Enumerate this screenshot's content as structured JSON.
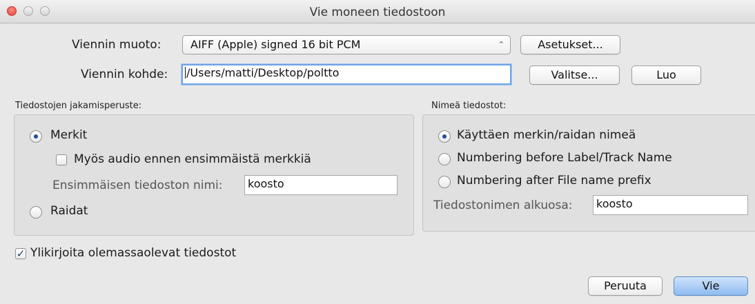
{
  "window": {
    "title": "Vie moneen tiedostoon"
  },
  "format": {
    "label": "Viennin muoto:",
    "selected": "AIFF (Apple) signed 16 bit PCM",
    "settings_button": "Asetukset..."
  },
  "destination": {
    "label": "Viennin kohde:",
    "value": "/Users/matti/Desktop/poltto",
    "choose_button": "Valitse...",
    "create_button": "Luo"
  },
  "split": {
    "heading": "Tiedostojen jakamisperuste:",
    "option_markers": "Merkit",
    "markers_selected": true,
    "include_audio_before": "Myös audio ennen ensimmäistä merkkiä",
    "include_audio_checked": false,
    "first_file_name_label": "Ensimmäisen tiedoston nimi:",
    "first_file_name_value": "koosto",
    "option_tracks": "Raidat",
    "tracks_selected": false
  },
  "naming": {
    "heading": "Nimeä tiedostot:",
    "option_label_name": "Käyttäen merkin/raidan nimeä",
    "option_numbering_before": "Numbering before Label/Track Name",
    "option_numbering_after": "Numbering after File name prefix",
    "selected": "option_label_name",
    "prefix_label": "Tiedostonimen alkuosa:",
    "prefix_value": "koosto"
  },
  "overwrite": {
    "label": "Ylikirjoita olemassaolevat tiedostot",
    "checked": true
  },
  "actions": {
    "cancel": "Peruuta",
    "export": "Vie"
  },
  "colors": {
    "accent": "#8fbcf0",
    "close_button": "#e0443e",
    "radio_dot": "#1d4f96"
  }
}
